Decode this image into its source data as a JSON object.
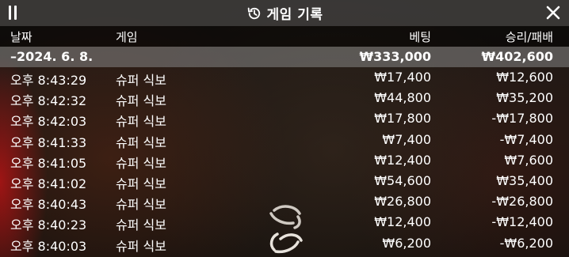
{
  "header": {
    "title": "게임 기록",
    "menu_icon": "pause-menu-icon",
    "history_icon": "history-clock-icon",
    "close_icon": "close-icon"
  },
  "table": {
    "columns": {
      "date": "날짜",
      "game": "게임",
      "bet": "베팅",
      "win_loss": "승리/패배"
    },
    "summary": {
      "date": "–2024. 6. 8.",
      "bet": "₩333,000",
      "win_loss": "₩402,600"
    },
    "rows": [
      {
        "time": "오후 8:43:29",
        "game": "슈퍼 식보",
        "bet": "₩17,400",
        "win_loss": "₩12,600"
      },
      {
        "time": "오후 8:42:32",
        "game": "슈퍼 식보",
        "bet": "₩44,800",
        "win_loss": "₩35,200"
      },
      {
        "time": "오후 8:42:03",
        "game": "슈퍼 식보",
        "bet": "₩17,800",
        "win_loss": "-₩17,800"
      },
      {
        "time": "오후 8:41:33",
        "game": "슈퍼 식보",
        "bet": "₩7,400",
        "win_loss": "-₩7,400"
      },
      {
        "time": "오후 8:41:05",
        "game": "슈퍼 식보",
        "bet": "₩12,400",
        "win_loss": "₩7,600"
      },
      {
        "time": "오후 8:41:02",
        "game": "슈퍼 식보",
        "bet": "₩54,600",
        "win_loss": "₩35,400"
      },
      {
        "time": "오후 8:40:43",
        "game": "슈퍼 식보",
        "bet": "₩26,800",
        "win_loss": "-₩26,800"
      },
      {
        "time": "오후 8:40:23",
        "game": "슈퍼 식보",
        "bet": "₩12,400",
        "win_loss": "-₩12,400"
      },
      {
        "time": "오후 8:40:03",
        "game": "슈퍼 식보",
        "bet": "₩6,200",
        "win_loss": "-₩6,200"
      }
    ]
  },
  "loader_icon": "loading-spinner-icon",
  "colors": {
    "text": "#ffffff",
    "topbar": "#3c3a38",
    "summary_row": "#878787"
  }
}
